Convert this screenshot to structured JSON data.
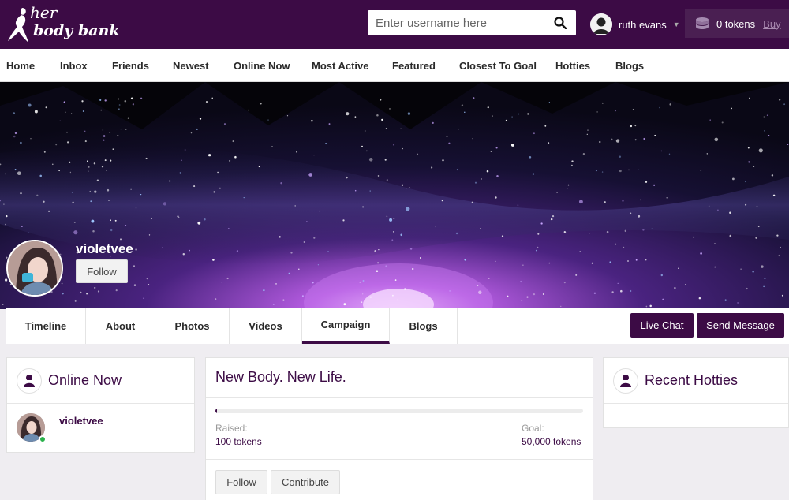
{
  "header": {
    "logo_top": "her",
    "logo_bottom": "body bank",
    "search_placeholder": "Enter username here",
    "user_name": "ruth evans",
    "tokens_label": "0 tokens",
    "buy_label": "Buy"
  },
  "nav": [
    {
      "label": "Home"
    },
    {
      "label": "Inbox"
    },
    {
      "label": "Friends"
    },
    {
      "label": "Newest"
    },
    {
      "label": "Online Now"
    },
    {
      "label": "Most Active"
    },
    {
      "label": "Featured"
    },
    {
      "label": "Closest To Goal"
    },
    {
      "label": "Hotties"
    },
    {
      "label": "Blogs"
    }
  ],
  "profile": {
    "username": "violetvee",
    "follow_label": "Follow"
  },
  "tabs": [
    {
      "label": "Timeline"
    },
    {
      "label": "About"
    },
    {
      "label": "Photos"
    },
    {
      "label": "Videos"
    },
    {
      "label": "Campaign",
      "active": true
    },
    {
      "label": "Blogs"
    }
  ],
  "actions": {
    "live_chat": "Live Chat",
    "send_message": "Send Message"
  },
  "online_now": {
    "title": "Online Now",
    "users": [
      {
        "name": "violetvee",
        "status": "online"
      }
    ]
  },
  "campaign": {
    "title": "New Body. New Life.",
    "raised_label": "Raised:",
    "raised_value": "100 tokens",
    "goal_label": "Goal:",
    "goal_value": "50,000 tokens",
    "progress_fraction": 0.002,
    "follow_label": "Follow",
    "contribute_label": "Contribute"
  },
  "recent_hotties": {
    "title": "Recent Hotties"
  },
  "colors": {
    "brand": "#3c0b45",
    "online": "#2bb24c"
  }
}
